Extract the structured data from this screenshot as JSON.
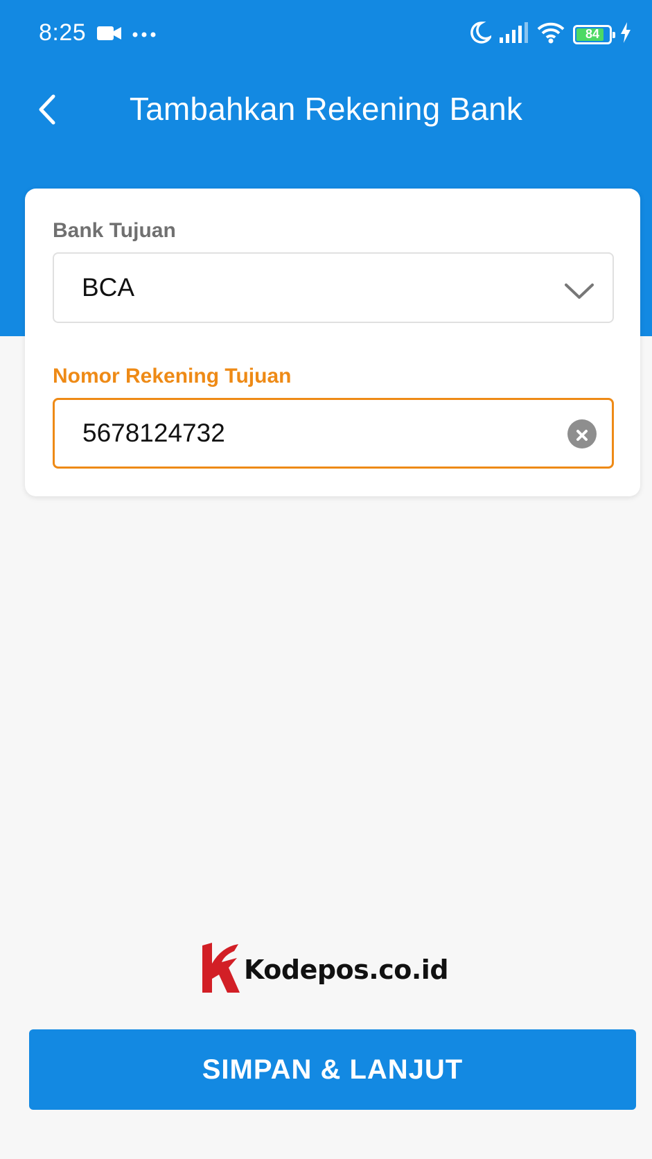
{
  "status_bar": {
    "time": "8:25",
    "battery_level": "84",
    "battery_fill_fraction": 0.84,
    "icons": [
      "video-camera-icon",
      "more-dots-icon",
      "moon-icon",
      "signal-icon",
      "wifi-icon",
      "battery-icon",
      "charging-bolt-icon"
    ]
  },
  "header": {
    "title": "Tambahkan Rekening Bank",
    "back_icon": "chevron-left-icon"
  },
  "form": {
    "bank_label": "Bank Tujuan",
    "bank_value": "BCA",
    "account_label": "Nomor Rekening Tujuan",
    "account_value": "5678124732"
  },
  "watermark": {
    "text": "Kodepos.co.id"
  },
  "footer": {
    "submit_label": "SIMPAN & LANJUT"
  },
  "colors": {
    "primary": "#1389e2",
    "accent": "#ee8a16",
    "background": "#f7f7f7",
    "logo_red": "#d21f26"
  }
}
